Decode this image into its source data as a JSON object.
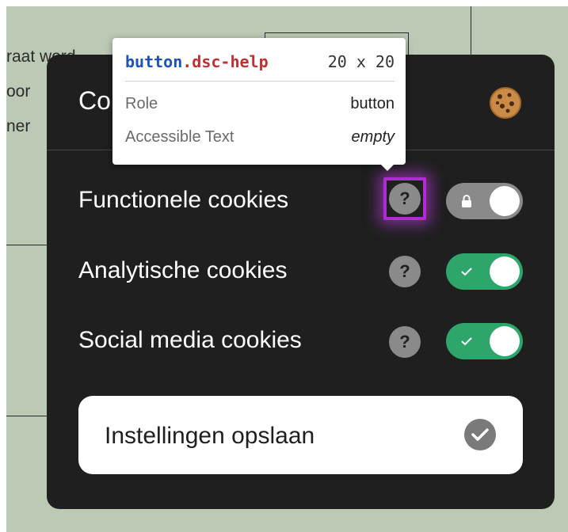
{
  "background": {
    "text_lines": [
      "raat word",
      "oor",
      "ner"
    ]
  },
  "modal": {
    "title": "Co",
    "cookie_icon": "cookie-icon",
    "rows": [
      {
        "label": "Functionele cookies",
        "help_text": "?",
        "toggle_state": "locked",
        "toggle_icon": "lock-icon"
      },
      {
        "label": "Analytische cookies",
        "help_text": "?",
        "toggle_state": "on",
        "toggle_icon": "check-icon"
      },
      {
        "label": "Social media cookies",
        "help_text": "?",
        "toggle_state": "on",
        "toggle_icon": "check-icon"
      }
    ],
    "save_button": {
      "label": "Instellingen opslaan",
      "icon": "check-circle-icon"
    }
  },
  "tooltip": {
    "tag": "button",
    "class_name": ".dsc-help",
    "dimensions": "20 x 20",
    "properties": [
      {
        "key": "Role",
        "value": "button"
      },
      {
        "key": "Accessible Text",
        "value": "empty"
      }
    ]
  },
  "colors": {
    "page_background": "#bccab5",
    "modal_background": "#1f1f1f",
    "toggle_on": "#2ea56b",
    "toggle_locked": "#8a8a8a",
    "highlight": "#b02bd4"
  }
}
